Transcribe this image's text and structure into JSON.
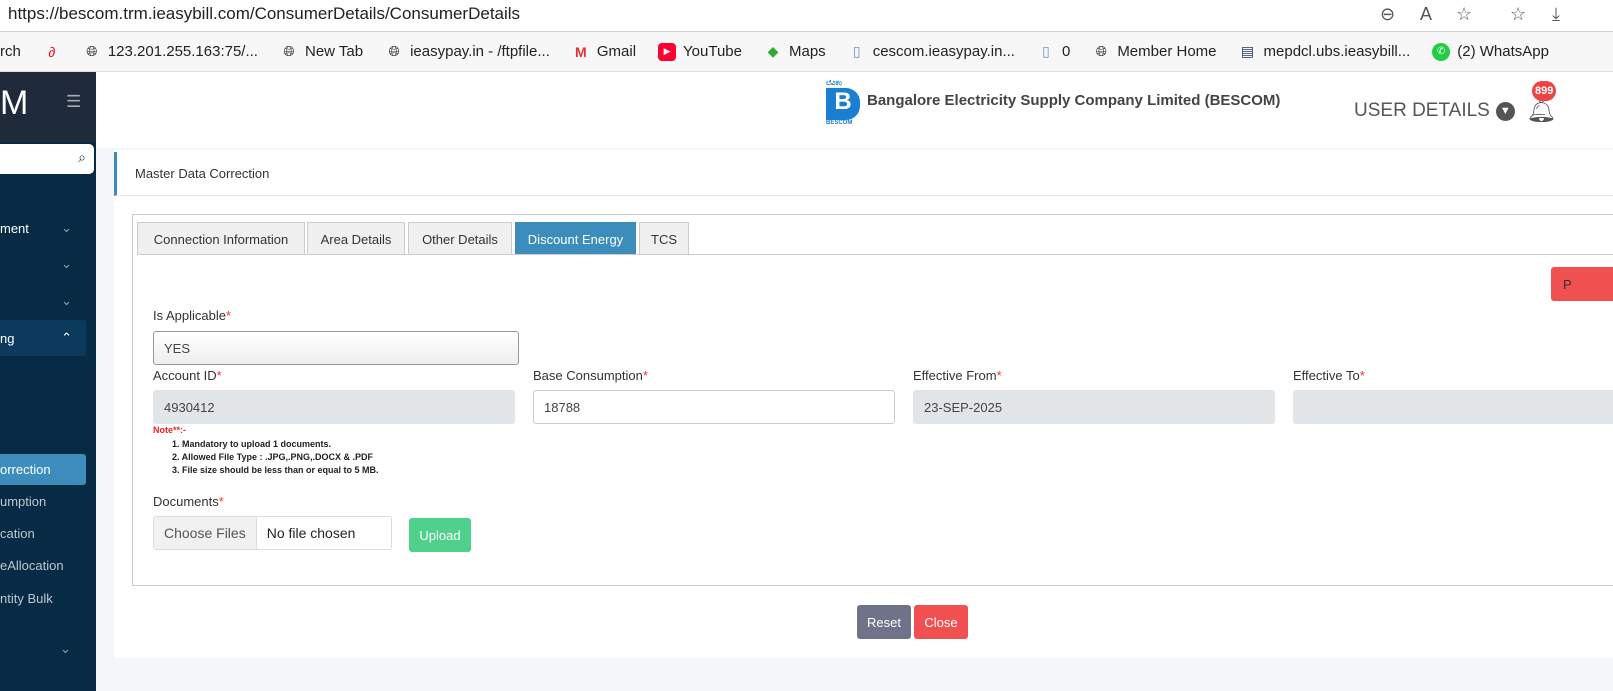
{
  "browser": {
    "url": "https://bescom.trm.ieasybill.com/ConsumerDetails/ConsumerDetails",
    "bookmarks": [
      {
        "label": "rch",
        "icon": "search-icon"
      },
      {
        "label": "",
        "icon": "airtel-icon"
      },
      {
        "label": "123.201.255.163:75/...",
        "icon": "globe-icon"
      },
      {
        "label": "New Tab",
        "icon": "globe-icon"
      },
      {
        "label": "ieasypay.in - /ftpfile...",
        "icon": "globe-icon"
      },
      {
        "label": "Gmail",
        "icon": "gmail-icon"
      },
      {
        "label": "YouTube",
        "icon": "youtube-icon"
      },
      {
        "label": "Maps",
        "icon": "maps-icon"
      },
      {
        "label": "cescom.ieasypay.in...",
        "icon": "page-icon"
      },
      {
        "label": "0",
        "icon": "page-icon"
      },
      {
        "label": "Member Home",
        "icon": "globe-icon"
      },
      {
        "label": "mepdcl.ubs.ieasybill...",
        "icon": "site-icon"
      },
      {
        "label": "(2) WhatsApp",
        "icon": "whatsapp-icon"
      }
    ]
  },
  "sidebar": {
    "logo": "M",
    "items": [
      {
        "label": "ment"
      },
      {
        "label": ""
      },
      {
        "label": ""
      },
      {
        "label": "ng"
      }
    ],
    "sub": [
      "orrection",
      "umption",
      "cation",
      "eAllocation",
      "ntity Bulk"
    ]
  },
  "header": {
    "company": "Bangalore Electricity Supply Company Limited (BESCOM)",
    "logo_text": "BESCOM",
    "logo_kannada": "ಬೆವಿಕಂ",
    "user": "USER DETAILS",
    "notif_count": "899"
  },
  "page": {
    "title": "Master Data Correction",
    "tabs": [
      "Connection Information",
      "Area Details",
      "Other Details",
      "Discount Energy",
      "TCS"
    ],
    "right_btn": "P",
    "is_applicable": {
      "label": "Is Applicable",
      "value": "YES"
    },
    "account_id": {
      "label": "Account ID",
      "value": "4930412"
    },
    "base_consumption": {
      "label": "Base Consumption",
      "value": "18788"
    },
    "effective_from": {
      "label": "Effective From",
      "value": "23-SEP-2025"
    },
    "effective_to": {
      "label": "Effective To",
      "value": ""
    },
    "note_label": "Note**:-",
    "notes": [
      "1. Mandatory to upload 1 documents.",
      "2. Allowed File Type : .JPG,.PNG,.DOCX & .PDF",
      "3. File size should be less than or equal to 5 MB."
    ],
    "documents": {
      "label": "Documents",
      "choose": "Choose Files",
      "status": "No file chosen",
      "upload": "Upload"
    },
    "reset": "Reset",
    "close": "Close"
  },
  "colors": {
    "primary": "#3c8dbc",
    "danger": "#f05050",
    "success": "#4fd18b",
    "sidebar": "#072a45"
  }
}
